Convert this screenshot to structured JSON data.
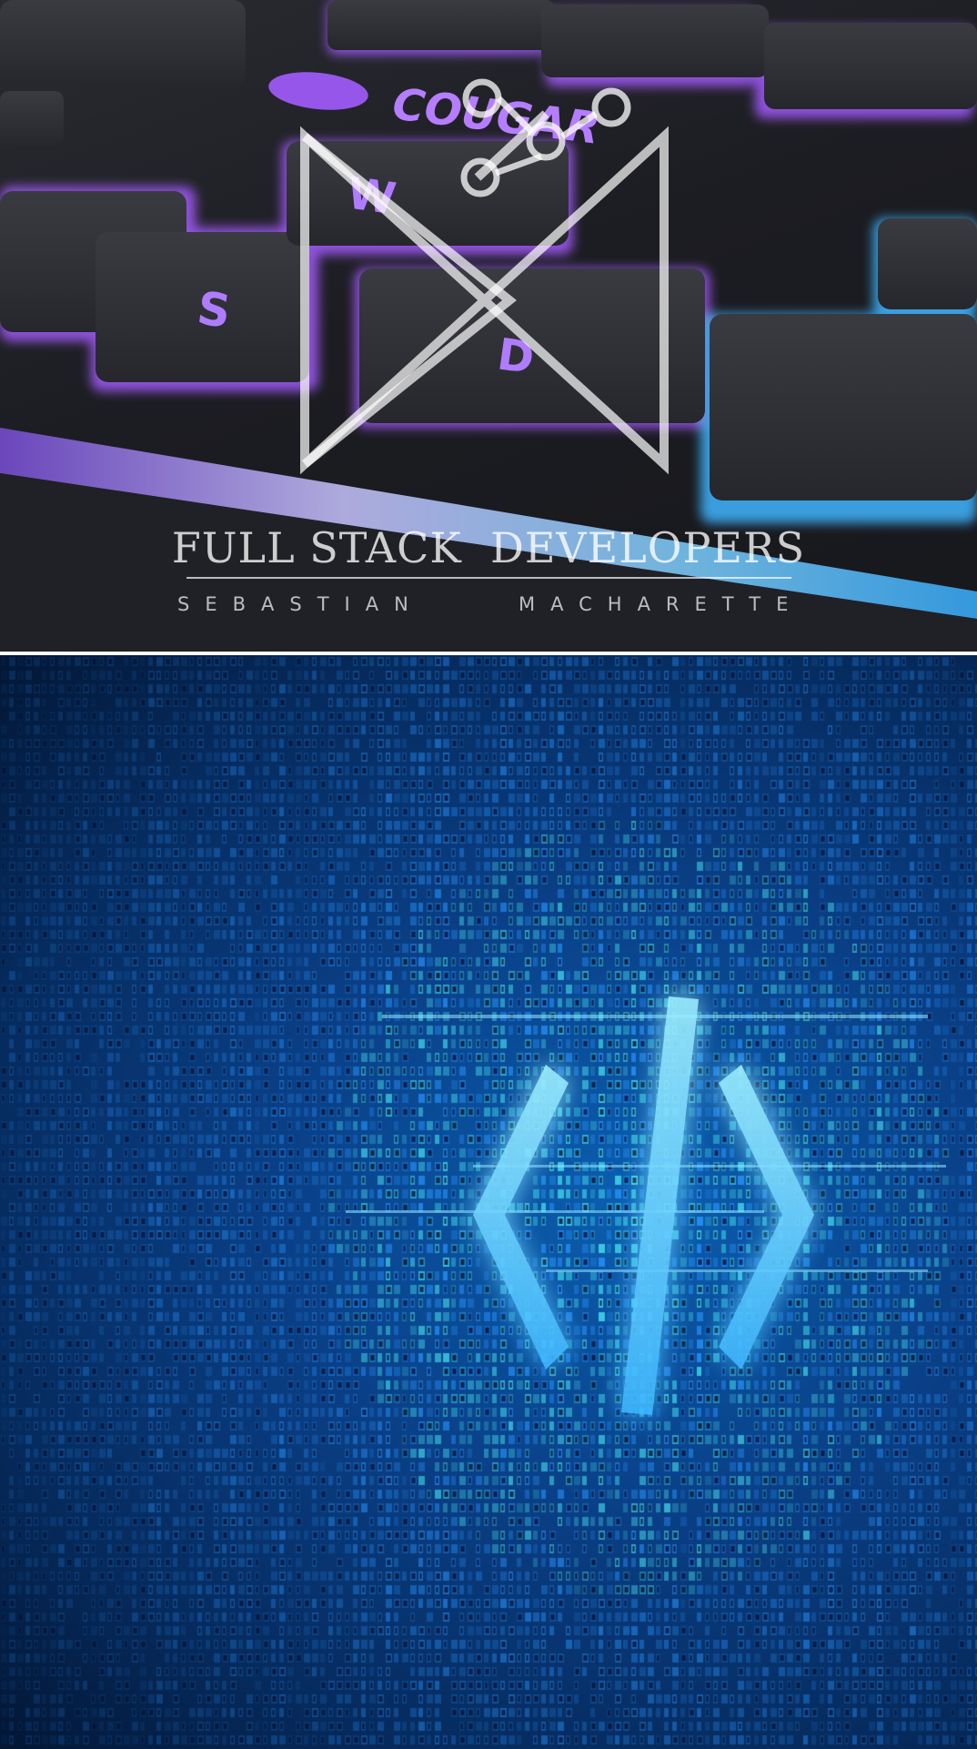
{
  "images": {
    "keyboard_photo": {
      "description_icon": "keyboard-photo",
      "keycaps": [
        "W",
        "S",
        "D"
      ],
      "brand_logo": "COUGAR"
    },
    "code_illustration": {
      "symbol": "</>",
      "icon": "code-brackets-icon"
    }
  },
  "watermark": {
    "title": "FULL STACK  DEVELOPERS",
    "subtitle_left": "SEBASTIAN",
    "subtitle_right": "MACHARETTE"
  },
  "colors": {
    "key_glow": "#a45cff",
    "edge_glow": "#7fd0ff",
    "matrix_blue": "#1e8fff",
    "matrix_cyan": "#39e0f0",
    "symbol_glow": "#7fe6ff"
  }
}
